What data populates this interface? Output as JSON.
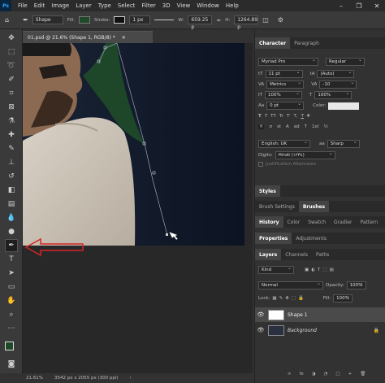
{
  "menubar": {
    "logo": "Ps",
    "items": [
      "File",
      "Edit",
      "Image",
      "Layer",
      "Type",
      "Select",
      "Filter",
      "3D",
      "View",
      "Window",
      "Help"
    ]
  },
  "options": {
    "shape_mode": "Shape",
    "fill_label": "Fill:",
    "stroke_label": "Stroke:",
    "stroke_width": "1 px",
    "w_label": "W:",
    "w_value": "659.25 p",
    "h_label": "H:",
    "h_value": "1264.89 p",
    "fill_color": "#1f4a2a",
    "stroke_color": "#111111"
  },
  "document": {
    "tab_title": "01.psd @ 21.6% (Shape 1, RGB/8) *",
    "zoom": "21.61%",
    "doc_info": "3542 px x 2055 px (300 ppi)"
  },
  "character": {
    "tabs": [
      "Character",
      "Paragraph"
    ],
    "font_family": "Myriad Pro",
    "font_style": "Regular",
    "font_size": "11 pt",
    "leading": "(Auto)",
    "kerning": "Metrics",
    "tracking": "-10",
    "vscale": "100%",
    "hscale": "100%",
    "baseline": "0 pt",
    "color_label": "Color:",
    "language": "English: UK",
    "antialias": "Sharp",
    "aa_label": "aa",
    "digits_label": "Digits:",
    "digits": "Hindi (١٢٣٤)",
    "justification": "Justification Alternates",
    "type_buttons": [
      "T",
      "T",
      "TT",
      "Tr",
      "T'",
      "T,",
      "T",
      "T"
    ],
    "opentype_buttons": [
      "fi",
      "σ",
      "st",
      "A",
      "ad",
      "T",
      "1st",
      "½"
    ]
  },
  "styles_tab": "Styles",
  "brush_tabs": [
    "Brush Settings",
    "Brushes"
  ],
  "history_tabs": [
    "History",
    "Color",
    "Swatch",
    "Gradier",
    "Pattern"
  ],
  "prop_tabs": [
    "Properties",
    "Adjustments"
  ],
  "layers": {
    "tabs": [
      "Layers",
      "Channels",
      "Paths"
    ],
    "kind": "Kind",
    "blend": "Normal",
    "opacity_label": "Opacity:",
    "opacity": "100%",
    "lock_label": "Lock:",
    "fill_label": "Fill:",
    "fill": "100%",
    "rows": [
      {
        "name": "Shape 1",
        "selected": true
      },
      {
        "name": "Background",
        "selected": false
      }
    ],
    "footer_icons": [
      "∞",
      "fx",
      "◑",
      "◔",
      "□",
      "+",
      "🗑"
    ]
  }
}
